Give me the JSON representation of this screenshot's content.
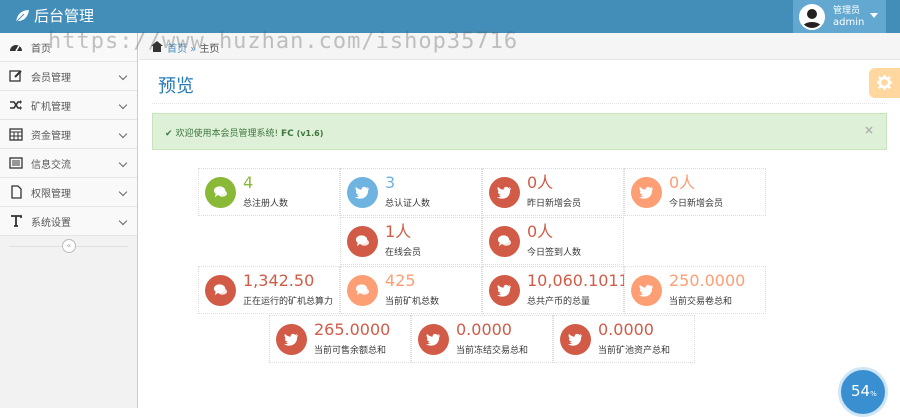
{
  "app": {
    "title": "后台管理"
  },
  "user": {
    "role": "管理员",
    "name": "admin"
  },
  "sidebar": {
    "items": [
      {
        "label": "首页",
        "icon": "dashboard-icon"
      },
      {
        "label": "会员管理",
        "icon": "edit-icon"
      },
      {
        "label": "矿机管理",
        "icon": "shuffle-icon"
      },
      {
        "label": "资金管理",
        "icon": "calendar-icon"
      },
      {
        "label": "信息交流",
        "icon": "list-icon"
      },
      {
        "label": "权限管理",
        "icon": "file-icon"
      },
      {
        "label": "系统设置",
        "icon": "text-icon"
      }
    ],
    "collapse_label": "«"
  },
  "breadcrumb": {
    "home": "首页",
    "sep": "»",
    "current": "主页"
  },
  "watermark": "https://www.huzhan.com/ishop35716",
  "page": {
    "title": "预览"
  },
  "alert": {
    "check": "✔",
    "text": "欢迎使用本会员管理系统!",
    "brand": "FC",
    "version": "(v1.6)",
    "close": "×"
  },
  "stats": [
    {
      "value": "4",
      "label": "总注册人数",
      "color": "#8ab938",
      "icon": "comments-icon"
    },
    {
      "value": "3",
      "label": "总认证人数",
      "color": "#6fb3e0",
      "icon": "twitter-icon"
    },
    {
      "value": "0人",
      "label": "昨日新增会员",
      "color": "#d15b47",
      "icon": "twitter-icon"
    },
    {
      "value": "0人",
      "label": "今日新增会员",
      "color": "#fe9e74",
      "icon": "twitter-icon"
    },
    {
      "value": "1人",
      "label": "在线会员",
      "color": "#d15b47",
      "icon": "comments-icon"
    },
    {
      "value": "0人",
      "label": "今日签到人数",
      "color": "#d15b47",
      "icon": "comments-icon"
    },
    {
      "value": "1,342.50",
      "label": "正在运行的矿机总算力",
      "color": "#d15b47",
      "icon": "comments-icon"
    },
    {
      "value": "425",
      "label": "当前矿机总数",
      "color": "#fe9e74",
      "icon": "comments-icon"
    },
    {
      "value": "10,060.1011",
      "label": "总共产币的总量",
      "color": "#d15b47",
      "icon": "twitter-icon"
    },
    {
      "value": "250.0000",
      "label": "当前交易卷总和",
      "color": "#fe9e74",
      "icon": "twitter-icon"
    },
    {
      "value": "265.0000",
      "label": "当前可售余额总和",
      "color": "#d15b47",
      "icon": "twitter-icon"
    },
    {
      "value": "0.0000",
      "label": "当前冻结交易总和",
      "color": "#d15b47",
      "icon": "twitter-icon"
    },
    {
      "value": "0.0000",
      "label": "当前矿池资产总和",
      "color": "#d15b47",
      "icon": "twitter-icon"
    }
  ],
  "badge": {
    "value": "54",
    "unit": "%"
  }
}
